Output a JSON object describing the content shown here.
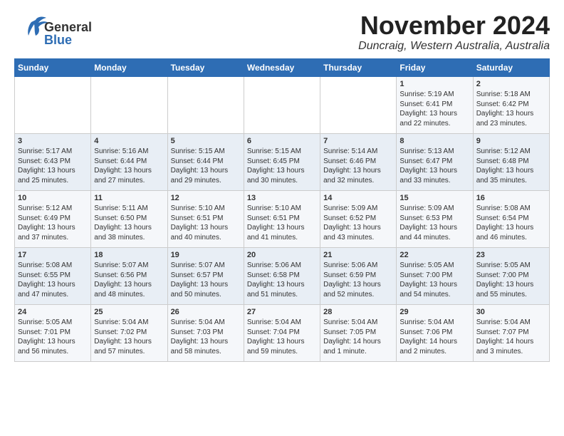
{
  "header": {
    "logo_general": "General",
    "logo_blue": "Blue",
    "month": "November 2024",
    "location": "Duncraig, Western Australia, Australia"
  },
  "weekdays": [
    "Sunday",
    "Monday",
    "Tuesday",
    "Wednesday",
    "Thursday",
    "Friday",
    "Saturday"
  ],
  "weeks": [
    [
      {
        "day": "",
        "info": ""
      },
      {
        "day": "",
        "info": ""
      },
      {
        "day": "",
        "info": ""
      },
      {
        "day": "",
        "info": ""
      },
      {
        "day": "",
        "info": ""
      },
      {
        "day": "1",
        "info": "Sunrise: 5:19 AM\nSunset: 6:41 PM\nDaylight: 13 hours\nand 22 minutes."
      },
      {
        "day": "2",
        "info": "Sunrise: 5:18 AM\nSunset: 6:42 PM\nDaylight: 13 hours\nand 23 minutes."
      }
    ],
    [
      {
        "day": "3",
        "info": "Sunrise: 5:17 AM\nSunset: 6:43 PM\nDaylight: 13 hours\nand 25 minutes."
      },
      {
        "day": "4",
        "info": "Sunrise: 5:16 AM\nSunset: 6:44 PM\nDaylight: 13 hours\nand 27 minutes."
      },
      {
        "day": "5",
        "info": "Sunrise: 5:15 AM\nSunset: 6:44 PM\nDaylight: 13 hours\nand 29 minutes."
      },
      {
        "day": "6",
        "info": "Sunrise: 5:15 AM\nSunset: 6:45 PM\nDaylight: 13 hours\nand 30 minutes."
      },
      {
        "day": "7",
        "info": "Sunrise: 5:14 AM\nSunset: 6:46 PM\nDaylight: 13 hours\nand 32 minutes."
      },
      {
        "day": "8",
        "info": "Sunrise: 5:13 AM\nSunset: 6:47 PM\nDaylight: 13 hours\nand 33 minutes."
      },
      {
        "day": "9",
        "info": "Sunrise: 5:12 AM\nSunset: 6:48 PM\nDaylight: 13 hours\nand 35 minutes."
      }
    ],
    [
      {
        "day": "10",
        "info": "Sunrise: 5:12 AM\nSunset: 6:49 PM\nDaylight: 13 hours\nand 37 minutes."
      },
      {
        "day": "11",
        "info": "Sunrise: 5:11 AM\nSunset: 6:50 PM\nDaylight: 13 hours\nand 38 minutes."
      },
      {
        "day": "12",
        "info": "Sunrise: 5:10 AM\nSunset: 6:51 PM\nDaylight: 13 hours\nand 40 minutes."
      },
      {
        "day": "13",
        "info": "Sunrise: 5:10 AM\nSunset: 6:51 PM\nDaylight: 13 hours\nand 41 minutes."
      },
      {
        "day": "14",
        "info": "Sunrise: 5:09 AM\nSunset: 6:52 PM\nDaylight: 13 hours\nand 43 minutes."
      },
      {
        "day": "15",
        "info": "Sunrise: 5:09 AM\nSunset: 6:53 PM\nDaylight: 13 hours\nand 44 minutes."
      },
      {
        "day": "16",
        "info": "Sunrise: 5:08 AM\nSunset: 6:54 PM\nDaylight: 13 hours\nand 46 minutes."
      }
    ],
    [
      {
        "day": "17",
        "info": "Sunrise: 5:08 AM\nSunset: 6:55 PM\nDaylight: 13 hours\nand 47 minutes."
      },
      {
        "day": "18",
        "info": "Sunrise: 5:07 AM\nSunset: 6:56 PM\nDaylight: 13 hours\nand 48 minutes."
      },
      {
        "day": "19",
        "info": "Sunrise: 5:07 AM\nSunset: 6:57 PM\nDaylight: 13 hours\nand 50 minutes."
      },
      {
        "day": "20",
        "info": "Sunrise: 5:06 AM\nSunset: 6:58 PM\nDaylight: 13 hours\nand 51 minutes."
      },
      {
        "day": "21",
        "info": "Sunrise: 5:06 AM\nSunset: 6:59 PM\nDaylight: 13 hours\nand 52 minutes."
      },
      {
        "day": "22",
        "info": "Sunrise: 5:05 AM\nSunset: 7:00 PM\nDaylight: 13 hours\nand 54 minutes."
      },
      {
        "day": "23",
        "info": "Sunrise: 5:05 AM\nSunset: 7:00 PM\nDaylight: 13 hours\nand 55 minutes."
      }
    ],
    [
      {
        "day": "24",
        "info": "Sunrise: 5:05 AM\nSunset: 7:01 PM\nDaylight: 13 hours\nand 56 minutes."
      },
      {
        "day": "25",
        "info": "Sunrise: 5:04 AM\nSunset: 7:02 PM\nDaylight: 13 hours\nand 57 minutes."
      },
      {
        "day": "26",
        "info": "Sunrise: 5:04 AM\nSunset: 7:03 PM\nDaylight: 13 hours\nand 58 minutes."
      },
      {
        "day": "27",
        "info": "Sunrise: 5:04 AM\nSunset: 7:04 PM\nDaylight: 13 hours\nand 59 minutes."
      },
      {
        "day": "28",
        "info": "Sunrise: 5:04 AM\nSunset: 7:05 PM\nDaylight: 14 hours\nand 1 minute."
      },
      {
        "day": "29",
        "info": "Sunrise: 5:04 AM\nSunset: 7:06 PM\nDaylight: 14 hours\nand 2 minutes."
      },
      {
        "day": "30",
        "info": "Sunrise: 5:04 AM\nSunset: 7:07 PM\nDaylight: 14 hours\nand 3 minutes."
      }
    ]
  ]
}
